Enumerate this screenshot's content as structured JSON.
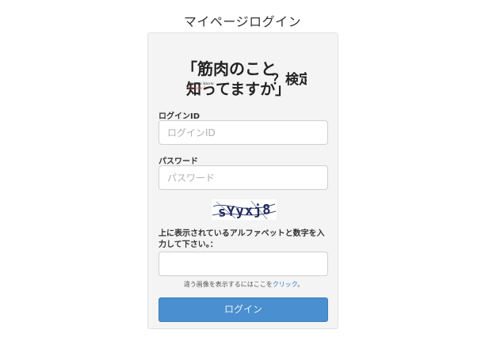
{
  "header": {
    "title": "マイページログイン"
  },
  "logo": {
    "line1": "「筋肉のこと",
    "line2": "知ってますか」",
    "suffix": "？検定",
    "small_en1": "Do you know",
    "small_en2": "muscle ?"
  },
  "form": {
    "login_id": {
      "label": "ログインID",
      "placeholder": "ログインID",
      "value": ""
    },
    "password": {
      "label": "パスワード",
      "placeholder": "パスワード",
      "value": ""
    },
    "captcha": {
      "text": "sYyxj8"
    },
    "instruction": "上に表示されているアルファベットと数字を入力して下さい。：",
    "captcha_input": {
      "value": ""
    },
    "refresh_note": {
      "before": "違う画像を表示するにはここを",
      "link": "クリック",
      "after": "。"
    },
    "submit_label": "ログイン"
  },
  "colors": {
    "button": "#4a8fcf",
    "logo_accent": "#c0392b",
    "link": "#2a7bd0"
  }
}
